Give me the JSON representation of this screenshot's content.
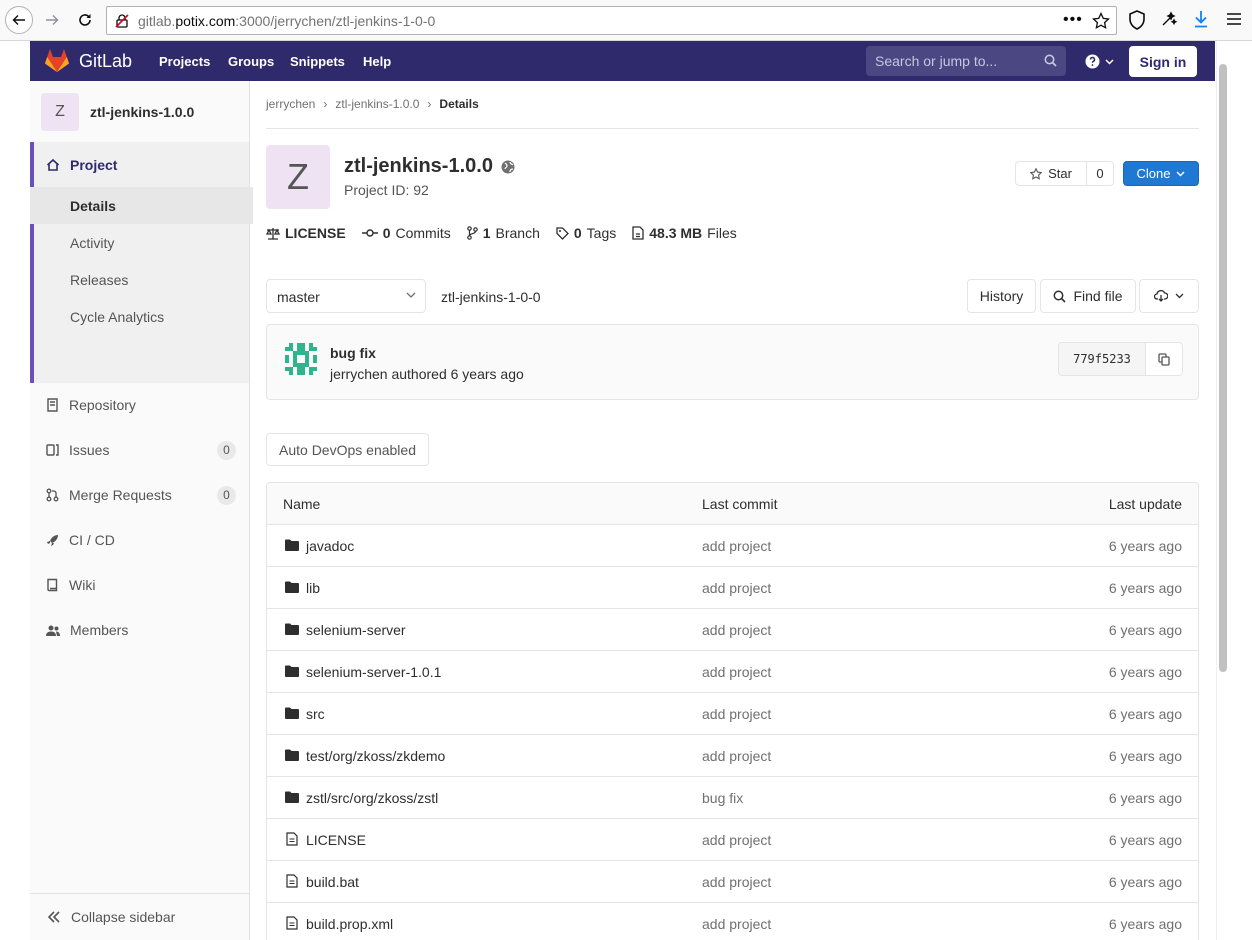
{
  "browser": {
    "url_prefix": "gitlab.",
    "url_domain": "potix.com",
    "url_rest": ":3000/jerrychen/ztl-jenkins-1-0-0",
    "icons": [
      "back-icon",
      "forward-icon",
      "reload-icon",
      "insecure-lock-icon",
      "page-actions-icon",
      "bookmark-star-icon",
      "shield-icon",
      "extension-icon",
      "download-icon",
      "menu-icon"
    ]
  },
  "topnav": {
    "brand": "GitLab",
    "links": [
      "Projects",
      "Groups",
      "Snippets",
      "Help"
    ],
    "search_placeholder": "Search or jump to...",
    "sign_in": "Sign in",
    "bg": "#2f2a6b"
  },
  "sidebar": {
    "avatar_letter": "Z",
    "project_name": "ztl-jenkins-1.0.0",
    "project_label": "Project",
    "project_subitems": [
      "Details",
      "Activity",
      "Releases",
      "Cycle Analytics"
    ],
    "items": [
      {
        "label": "Repository",
        "icon": "repository-icon"
      },
      {
        "label": "Issues",
        "icon": "issues-icon",
        "count": "0"
      },
      {
        "label": "Merge Requests",
        "icon": "merge-request-icon",
        "count": "0"
      },
      {
        "label": "CI / CD",
        "icon": "rocket-icon"
      },
      {
        "label": "Wiki",
        "icon": "book-icon"
      },
      {
        "label": "Members",
        "icon": "users-icon"
      }
    ],
    "collapse": "Collapse sidebar"
  },
  "breadcrumb": [
    "jerrychen",
    "ztl-jenkins-1.0.0",
    "Details"
  ],
  "project": {
    "avatar_letter": "Z",
    "title": "ztl-jenkins-1.0.0",
    "project_id": "Project ID: 92",
    "star_label": "Star",
    "star_count": "0",
    "clone_label": "Clone",
    "accent": "#1f78d1"
  },
  "stats": {
    "license": "LICENSE",
    "commits_n": "0",
    "commits_l": "Commits",
    "branch_n": "1",
    "branch_l": "Branch",
    "tags_n": "0",
    "tags_l": "Tags",
    "files_n": "48.3 MB",
    "files_l": "Files"
  },
  "repo_bar": {
    "branch": "master",
    "path": "ztl-jenkins-1-0-0",
    "history": "History",
    "find_file": "Find file"
  },
  "last_commit": {
    "message": "bug fix",
    "meta": "jerrychen authored 6 years ago",
    "sha": "779f5233"
  },
  "auto_devops": "Auto DevOps enabled",
  "tree": {
    "headers": [
      "Name",
      "Last commit",
      "Last update"
    ],
    "rows": [
      {
        "name": "javadoc",
        "type": "folder",
        "commit": "add project",
        "updated": "6 years ago"
      },
      {
        "name": "lib",
        "type": "folder",
        "commit": "add project",
        "updated": "6 years ago"
      },
      {
        "name": "selenium-server",
        "type": "folder",
        "commit": "add project",
        "updated": "6 years ago"
      },
      {
        "name": "selenium-server-1.0.1",
        "type": "folder",
        "commit": "add project",
        "updated": "6 years ago"
      },
      {
        "name": "src",
        "type": "folder",
        "commit": "add project",
        "updated": "6 years ago"
      },
      {
        "name": "test/org/zkoss/zkdemo",
        "type": "folder",
        "commit": "add project",
        "updated": "6 years ago"
      },
      {
        "name": "zstl/src/org/zkoss/zstl",
        "type": "folder",
        "commit": "bug fix",
        "updated": "6 years ago"
      },
      {
        "name": "LICENSE",
        "type": "file",
        "commit": "add project",
        "updated": "6 years ago"
      },
      {
        "name": "build.bat",
        "type": "file",
        "commit": "add project",
        "updated": "6 years ago"
      },
      {
        "name": "build.prop.xml",
        "type": "file",
        "commit": "add project",
        "updated": "6 years ago"
      }
    ]
  }
}
